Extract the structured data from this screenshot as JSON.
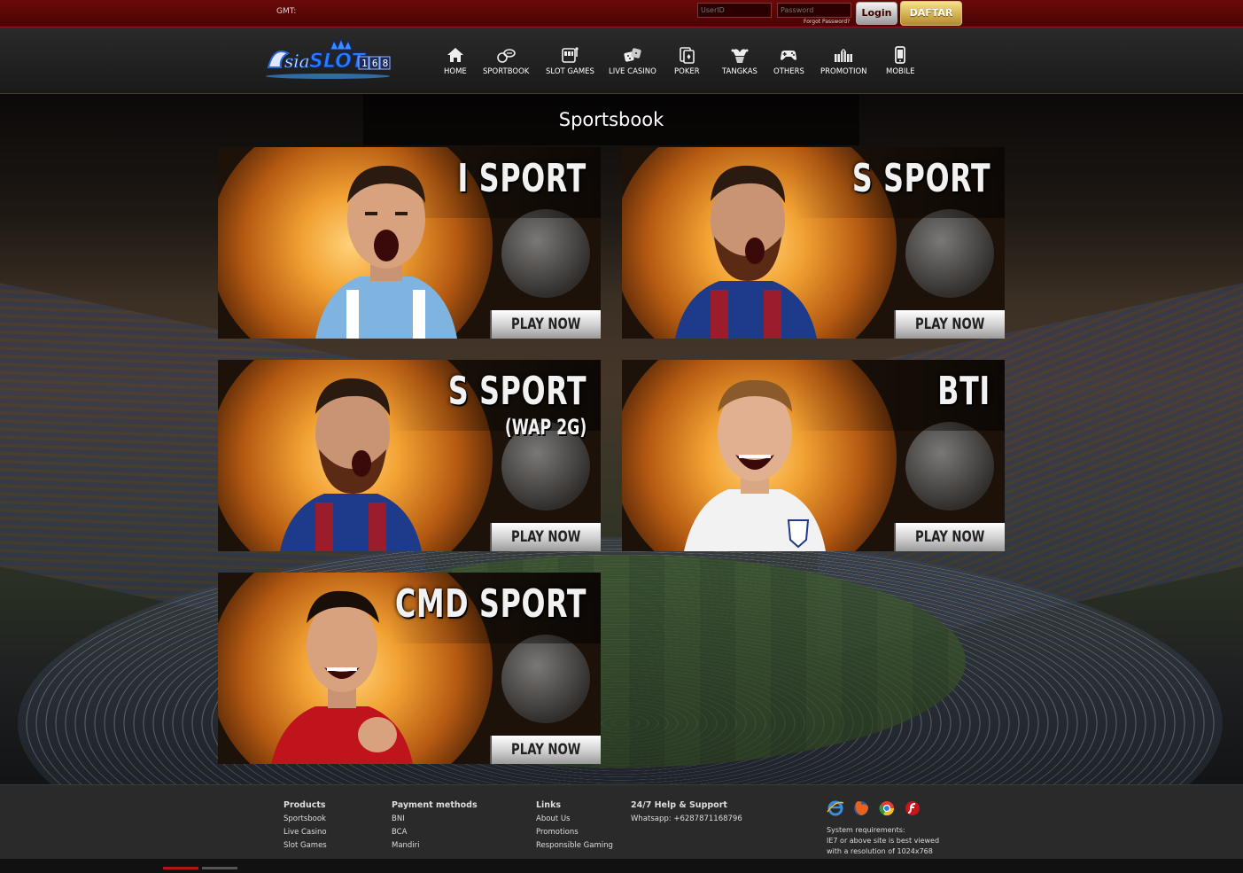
{
  "topbar": {
    "gmt_label": "GMT:",
    "userid_placeholder": "UserID",
    "password_placeholder": "Password",
    "forgot_password": "Forgot Password?",
    "login_button": "Login",
    "register_button": "DAFTAR"
  },
  "brand": {
    "logo_text_a": "sia",
    "logo_text_b": "SLOT",
    "logo_text_c": "168"
  },
  "nav": {
    "items": [
      {
        "label": "HOME",
        "icon": "home-icon"
      },
      {
        "label": "SPORTBOOK",
        "icon": "sportsbook-icon"
      },
      {
        "label": "SLOT GAMES",
        "icon": "slot-machine-icon"
      },
      {
        "label": "LIVE CASINO",
        "icon": "dice-icon"
      },
      {
        "label": "POKER",
        "icon": "cards-icon"
      },
      {
        "label": "TANGKAS",
        "icon": "joker-icon"
      },
      {
        "label": "OTHERS",
        "icon": "gamepad-icon"
      },
      {
        "label": "PROMOTION",
        "icon": "gifts-icon"
      },
      {
        "label": "MOBILE",
        "icon": "mobile-icon"
      }
    ]
  },
  "page": {
    "title": "Sportsbook"
  },
  "games": [
    {
      "name": "I SPORT",
      "subtitle": "",
      "play_label": "PLAY NOW",
      "shirt": "#7fb4e0",
      "shirt2": "#ffffff"
    },
    {
      "name": "S SPORT",
      "subtitle": "",
      "play_label": "PLAY NOW",
      "shirt": "#1e3a8a",
      "shirt2": "#9b1d2c"
    },
    {
      "name": "S SPORT",
      "subtitle": "(WAP 2G)",
      "play_label": "PLAY NOW",
      "shirt": "#1e3a8a",
      "shirt2": "#9b1d2c"
    },
    {
      "name": "BTI",
      "subtitle": "",
      "play_label": "PLAY NOW",
      "shirt": "#f2f2f2",
      "shirt2": "#e0e0e0"
    },
    {
      "name": "CMD SPORT",
      "subtitle": "",
      "play_label": "PLAY NOW",
      "shirt": "#c0141c",
      "shirt2": "#e02a2a"
    }
  ],
  "footer": {
    "products": {
      "heading": "Products",
      "links": [
        "Sportsbook",
        "Live Casino",
        "Slot Games"
      ]
    },
    "payment": {
      "heading": "Payment methods",
      "links": [
        "BNI",
        "BCA",
        "Mandiri"
      ]
    },
    "links": {
      "heading": "Links",
      "links": [
        "About Us",
        "Promotions",
        "Responsible Gaming"
      ]
    },
    "support": {
      "heading": "24/7 Help & Support",
      "whatsapp": "Whatsapp: +6287871168796"
    },
    "browsers": [
      "ie-icon",
      "firefox-icon",
      "chrome-icon",
      "flash-icon"
    ],
    "sysreq": [
      "System requirements:",
      "IE7 or above site is best viewed",
      "with a resolution of 1024x768"
    ]
  }
}
